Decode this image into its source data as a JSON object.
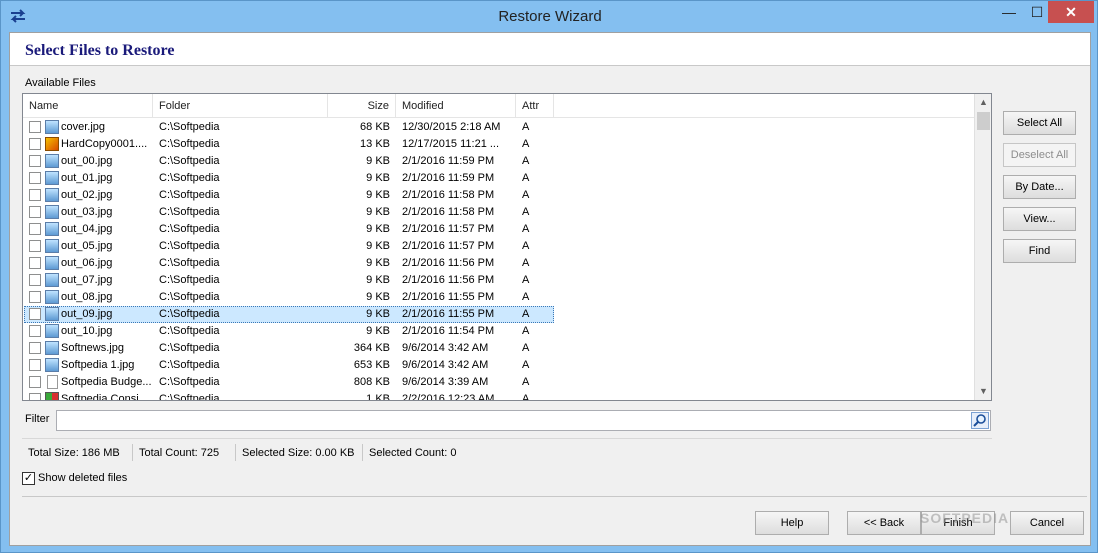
{
  "window": {
    "title": "Restore Wizard",
    "controls": {
      "minimize": "—",
      "maximize": "☐",
      "close": "✕"
    }
  },
  "page": {
    "title": "Select Files to Restore",
    "group_label": "Available Files"
  },
  "table": {
    "columns": [
      "Name",
      "Folder",
      "Size",
      "Modified",
      "Attr"
    ],
    "rows": [
      {
        "name": "cover.jpg",
        "folder": "C:\\Softpedia",
        "size": "68 KB",
        "modified": "12/30/2015 2:18 AM",
        "attr": "A",
        "icon": "image-icon"
      },
      {
        "name": "HardCopy0001....",
        "folder": "C:\\Softpedia",
        "size": "13 KB",
        "modified": "12/17/2015 11:21 ...",
        "attr": "A",
        "icon": "hardcopy-icon"
      },
      {
        "name": "out_00.jpg",
        "folder": "C:\\Softpedia",
        "size": "9 KB",
        "modified": "2/1/2016 11:59 PM",
        "attr": "A",
        "icon": "image-icon"
      },
      {
        "name": "out_01.jpg",
        "folder": "C:\\Softpedia",
        "size": "9 KB",
        "modified": "2/1/2016 11:59 PM",
        "attr": "A",
        "icon": "image-icon"
      },
      {
        "name": "out_02.jpg",
        "folder": "C:\\Softpedia",
        "size": "9 KB",
        "modified": "2/1/2016 11:58 PM",
        "attr": "A",
        "icon": "image-icon"
      },
      {
        "name": "out_03.jpg",
        "folder": "C:\\Softpedia",
        "size": "9 KB",
        "modified": "2/1/2016 11:58 PM",
        "attr": "A",
        "icon": "image-icon"
      },
      {
        "name": "out_04.jpg",
        "folder": "C:\\Softpedia",
        "size": "9 KB",
        "modified": "2/1/2016 11:57 PM",
        "attr": "A",
        "icon": "image-icon"
      },
      {
        "name": "out_05.jpg",
        "folder": "C:\\Softpedia",
        "size": "9 KB",
        "modified": "2/1/2016 11:57 PM",
        "attr": "A",
        "icon": "image-icon"
      },
      {
        "name": "out_06.jpg",
        "folder": "C:\\Softpedia",
        "size": "9 KB",
        "modified": "2/1/2016 11:56 PM",
        "attr": "A",
        "icon": "image-icon"
      },
      {
        "name": "out_07.jpg",
        "folder": "C:\\Softpedia",
        "size": "9 KB",
        "modified": "2/1/2016 11:56 PM",
        "attr": "A",
        "icon": "image-icon"
      },
      {
        "name": "out_08.jpg",
        "folder": "C:\\Softpedia",
        "size": "9 KB",
        "modified": "2/1/2016 11:55 PM",
        "attr": "A",
        "icon": "image-icon"
      },
      {
        "name": "out_09.jpg",
        "folder": "C:\\Softpedia",
        "size": "9 KB",
        "modified": "2/1/2016 11:55 PM",
        "attr": "A",
        "icon": "image-icon",
        "selected": true
      },
      {
        "name": "out_10.jpg",
        "folder": "C:\\Softpedia",
        "size": "9 KB",
        "modified": "2/1/2016 11:54 PM",
        "attr": "A",
        "icon": "image-icon"
      },
      {
        "name": "Softnews.jpg",
        "folder": "C:\\Softpedia",
        "size": "364 KB",
        "modified": "9/6/2014 3:42 AM",
        "attr": "A",
        "icon": "image-icon"
      },
      {
        "name": "Softpedia 1.jpg",
        "folder": "C:\\Softpedia",
        "size": "653 KB",
        "modified": "9/6/2014 3:42 AM",
        "attr": "A",
        "icon": "image-icon"
      },
      {
        "name": "Softpedia Budge...",
        "folder": "C:\\Softpedia",
        "size": "808 KB",
        "modified": "9/6/2014 3:39 AM",
        "attr": "A",
        "icon": "document-icon"
      },
      {
        "name": "Softpedia Consi...",
        "folder": "C:\\Softpedia",
        "size": "1 KB",
        "modified": "2/2/2016 12:23 AM",
        "attr": "A",
        "icon": "shortcut-icon"
      }
    ]
  },
  "side_buttons": {
    "select_all": "Select All",
    "deselect_all": "Deselect All",
    "by_date": "By Date...",
    "view": "View...",
    "find": "Find"
  },
  "filter": {
    "label": "Filter",
    "value": ""
  },
  "status": {
    "total_size": "Total Size: 186 MB",
    "total_count": "Total Count: 725",
    "selected_size": "Selected Size: 0.00 KB",
    "selected_count": "Selected Count: 0"
  },
  "show_deleted": {
    "label": "Show deleted files",
    "checked": true
  },
  "footer_buttons": {
    "help": "Help",
    "back": "<< Back",
    "finish": "Finish",
    "cancel": "Cancel"
  },
  "watermark": "SOFTPEDIA"
}
